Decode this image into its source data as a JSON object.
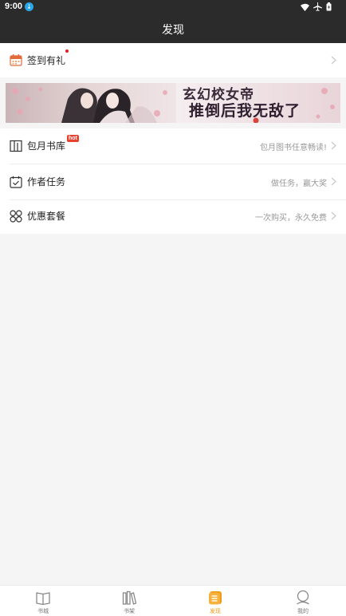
{
  "status_bar": {
    "time": "9:00",
    "download_badge": "↓"
  },
  "header": {
    "title": "发现"
  },
  "sign_in": {
    "label": "签到有礼"
  },
  "banner": {
    "line1": "玄幻校女帝",
    "line2": "推倒后我无敌了",
    "alt": "Promotional banner"
  },
  "menu": [
    {
      "label": "包月书库",
      "badge": "hot",
      "subtitle": "包月图书任意畅读!"
    },
    {
      "label": "作者任务",
      "subtitle": "做任务，赢大奖"
    },
    {
      "label": "优惠套餐",
      "subtitle": "一次购买，永久免费"
    }
  ],
  "tabs": [
    {
      "label": "书城",
      "icon": "book-open-icon"
    },
    {
      "label": "书架",
      "icon": "bookshelf-icon"
    },
    {
      "label": "发现",
      "icon": "discover-icon",
      "active": true
    },
    {
      "label": "我的",
      "icon": "profile-icon"
    }
  ],
  "colors": {
    "header_bg": "#2b2b2b",
    "accent": "#f39a14",
    "hot_badge": "#e8412f"
  }
}
